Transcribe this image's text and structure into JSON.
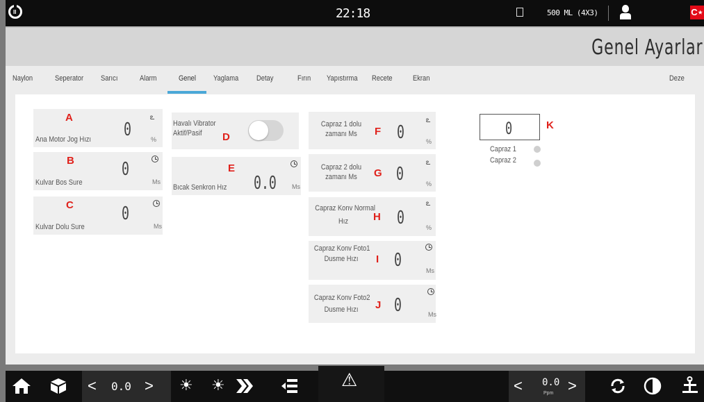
{
  "topbar": {
    "clock": "22:18",
    "recipe": "500 ML (4X3)",
    "flag_symbol": "C⋆"
  },
  "page": {
    "title": "Genel Ayarlar"
  },
  "tabs": [
    {
      "label": "Naylon"
    },
    {
      "label": "Seperator"
    },
    {
      "label": "Sarıcı"
    },
    {
      "label": "Alarm"
    },
    {
      "label": "Genel",
      "active": true
    },
    {
      "label": "Yaglama"
    },
    {
      "label": "Detay"
    },
    {
      "label": "Fırın"
    },
    {
      "label": "Yapıstırma"
    },
    {
      "label": "Recete"
    },
    {
      "label": "Ekran"
    },
    {
      "label": "Deze"
    }
  ],
  "cards": {
    "a": {
      "letter": "A",
      "label": "Ana Motor Jog Hızı",
      "value": "0",
      "unit": "%",
      "icon": "speed-icon"
    },
    "b": {
      "letter": "B",
      "label": "Kulvar Bos Sure",
      "value": "0",
      "unit": "Ms",
      "icon": "clock-icon"
    },
    "c": {
      "letter": "C",
      "label": "Kulvar Dolu Sure",
      "value": "0",
      "unit": "Ms",
      "icon": "clock-icon"
    },
    "d": {
      "letter": "D",
      "label_1": "Havalı Vibrator",
      "label_2": "Aktif/Pasif",
      "toggle_on": false
    },
    "e": {
      "letter": "E",
      "label": "Bıcak Senkron Hız",
      "value": "0.0",
      "unit": "Ms",
      "icon": "clock-icon"
    },
    "f": {
      "letter": "F",
      "label_1": "Capraz 1 dolu",
      "label_2": "zamanı Ms",
      "value": "0",
      "unit": "%",
      "icon": "speed-icon"
    },
    "g": {
      "letter": "G",
      "label_1": "Capraz 2 dolu",
      "label_2": "zamanı Ms",
      "value": "0",
      "unit": "%",
      "icon": "speed-icon"
    },
    "h": {
      "letter": "H",
      "label_1": "Capraz Konv Normal",
      "label_2": "Hız",
      "value": "0",
      "unit": "%",
      "icon": "speed-icon"
    },
    "i": {
      "letter": "I",
      "label_1": "Capraz Konv Foto1",
      "label_2": "Dusme Hızı",
      "value": "0",
      "unit": "Ms",
      "icon": "clock-icon"
    },
    "j": {
      "letter": "J",
      "label_1": "Capraz Konv Foto2",
      "label_2": "Dusme Hızı",
      "value": "0",
      "unit": "Ms",
      "icon": "clock-icon"
    }
  },
  "k_panel": {
    "letter": "K",
    "value": "0",
    "items": [
      {
        "label": "Capraz 1"
      },
      {
        "label": "Capraz 2"
      }
    ]
  },
  "bottombar": {
    "left_speed": "0.0",
    "right_speed": "0.0",
    "right_unit": "Ppm"
  }
}
